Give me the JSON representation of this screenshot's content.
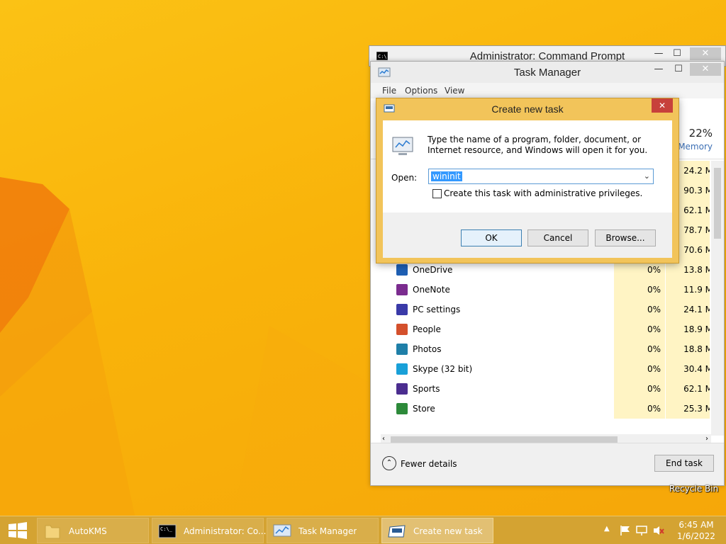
{
  "colors": {
    "desktop": "#f8b20b",
    "taskbar": "#d4a332",
    "dialog_frame": "#f2c45a",
    "close_red": "#c7413b",
    "selection": "#3399ff",
    "cpu_highlight": "#fff4c4"
  },
  "cmd_window": {
    "title": "Administrator: Command Prompt",
    "icon": "cmd-icon"
  },
  "task_manager": {
    "title": "Task Manager",
    "menu": [
      "File",
      "Options",
      "View"
    ],
    "memory": {
      "percent": "22%",
      "label": "Memory"
    },
    "rows": [
      {
        "name": "",
        "cpu": "",
        "mem": "24.2 M",
        "icon_color": "#999999"
      },
      {
        "name": "",
        "cpu": "",
        "mem": "90.3 M",
        "icon_color": "#999999"
      },
      {
        "name": "",
        "cpu": "",
        "mem": "62.1 M",
        "icon_color": "#999999"
      },
      {
        "name": "",
        "cpu": "",
        "mem": "78.7 M",
        "icon_color": "#999999"
      },
      {
        "name": "News",
        "cpu": "0%",
        "mem": "70.6 M",
        "icon_color": "#b8263c"
      },
      {
        "name": "OneDrive",
        "cpu": "0%",
        "mem": "13.8 M",
        "icon_color": "#1e5fb3"
      },
      {
        "name": "OneNote",
        "cpu": "0%",
        "mem": "11.9 M",
        "icon_color": "#7b2c8f"
      },
      {
        "name": "PC settings",
        "cpu": "0%",
        "mem": "24.1 M",
        "icon_color": "#3a3aa8"
      },
      {
        "name": "People",
        "cpu": "0%",
        "mem": "18.9 M",
        "icon_color": "#d4502c"
      },
      {
        "name": "Photos",
        "cpu": "0%",
        "mem": "18.8 M",
        "icon_color": "#1f7fa8"
      },
      {
        "name": "Skype (32 bit)",
        "cpu": "0%",
        "mem": "30.4 M",
        "icon_color": "#19a0d8"
      },
      {
        "name": "Sports",
        "cpu": "0%",
        "mem": "62.1 M",
        "icon_color": "#4b2d8f"
      },
      {
        "name": "Store",
        "cpu": "0%",
        "mem": "25.3 M",
        "icon_color": "#2d8a3a"
      }
    ],
    "fewer_details": "Fewer details",
    "end_task": "End task"
  },
  "dialog": {
    "title": "Create new task",
    "close": "✕",
    "description": "Type the name of a program, folder, document, or Internet resource, and Windows will open it for you.",
    "open_label": "Open:",
    "open_value": "wininit",
    "admin_checkbox_label": "Create this task with administrative privileges.",
    "ok": "OK",
    "cancel": "Cancel",
    "browse": "Browse..."
  },
  "desktop": {
    "recycle_bin": "Recycle Bin"
  },
  "taskbar": {
    "tasks": [
      {
        "label": "AutoKMS",
        "icon": "folder-icon"
      },
      {
        "label": "Administrator: Co...",
        "icon": "cmd-icon"
      },
      {
        "label": "Task Manager",
        "icon": "task-manager-icon"
      },
      {
        "label": "Create new task",
        "icon": "run-dialog-icon"
      }
    ],
    "time": "6:45 AM",
    "date": "1/6/2022"
  }
}
